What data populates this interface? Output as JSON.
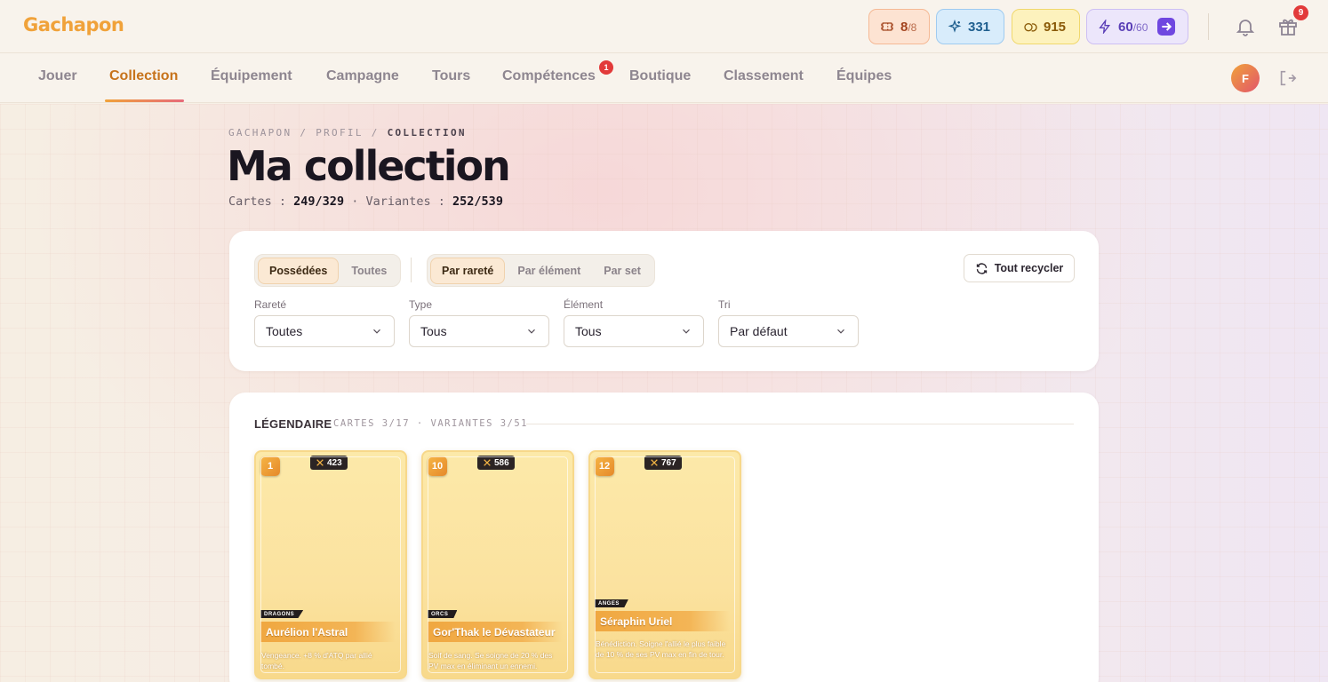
{
  "app": {
    "title": "Gachapon"
  },
  "resources": {
    "tickets": {
      "value": "8",
      "max": "/8"
    },
    "stars": {
      "value": "331"
    },
    "coins": {
      "value": "915"
    },
    "energy": {
      "value": "60",
      "max": "/60"
    }
  },
  "notifications": {
    "gift_count": "9"
  },
  "nav": {
    "tabs": [
      {
        "label": "Jouer"
      },
      {
        "label": "Collection",
        "active": true
      },
      {
        "label": "Équipement"
      },
      {
        "label": "Campagne"
      },
      {
        "label": "Tours"
      },
      {
        "label": "Compétences",
        "badge": "1"
      },
      {
        "label": "Boutique"
      },
      {
        "label": "Classement"
      },
      {
        "label": "Équipes"
      }
    ]
  },
  "user": {
    "initial": "F"
  },
  "breadcrumb": {
    "part1": "GACHAPON",
    "sep": "/",
    "part2": "PROFIL",
    "current": "COLLECTION"
  },
  "page": {
    "title": "Ma collection",
    "cards_label": "Cartes :",
    "cards_value": "249/329",
    "dot": "·",
    "variants_label": "Variantes :",
    "variants_value": "252/539"
  },
  "filters": {
    "ownership": {
      "options": [
        "Possédées",
        "Toutes"
      ],
      "selected": "Possédées"
    },
    "grouping": {
      "options": [
        "Par rareté",
        "Par élément",
        "Par set"
      ],
      "selected": "Par rareté"
    },
    "recycle_label": "Tout recycler",
    "selects": [
      {
        "label": "Rareté",
        "value": "Toutes"
      },
      {
        "label": "Type",
        "value": "Tous"
      },
      {
        "label": "Élément",
        "value": "Tous"
      },
      {
        "label": "Tri",
        "value": "Par défaut"
      }
    ]
  },
  "section": {
    "title": "LÉGENDAIRE",
    "meta": "CARTES 3/17 · VARIANTES 3/51",
    "cards": [
      {
        "level": "1",
        "power": "423",
        "faction": "DRAGONS",
        "name": "Aurélion l'Astral",
        "desc": "Vengeance. +8 % d'ATQ par allié tombé."
      },
      {
        "level": "10",
        "power": "586",
        "faction": "ORCS",
        "name": "Gor'Thak le Dévastateur",
        "desc": "Soif de sang. Se soigne de 20 % des PV max en éliminant un ennemi."
      },
      {
        "level": "12",
        "power": "767",
        "faction": "ANGES",
        "name": "Séraphin Uriel",
        "desc": "Bénédiction. Soigne l'allié le plus faible de 10 % de ses PV max en fin de tour."
      }
    ]
  },
  "colors": {
    "accent": "#c7731b",
    "brand": "#f0a23a",
    "legendary": "#fce9a9"
  }
}
